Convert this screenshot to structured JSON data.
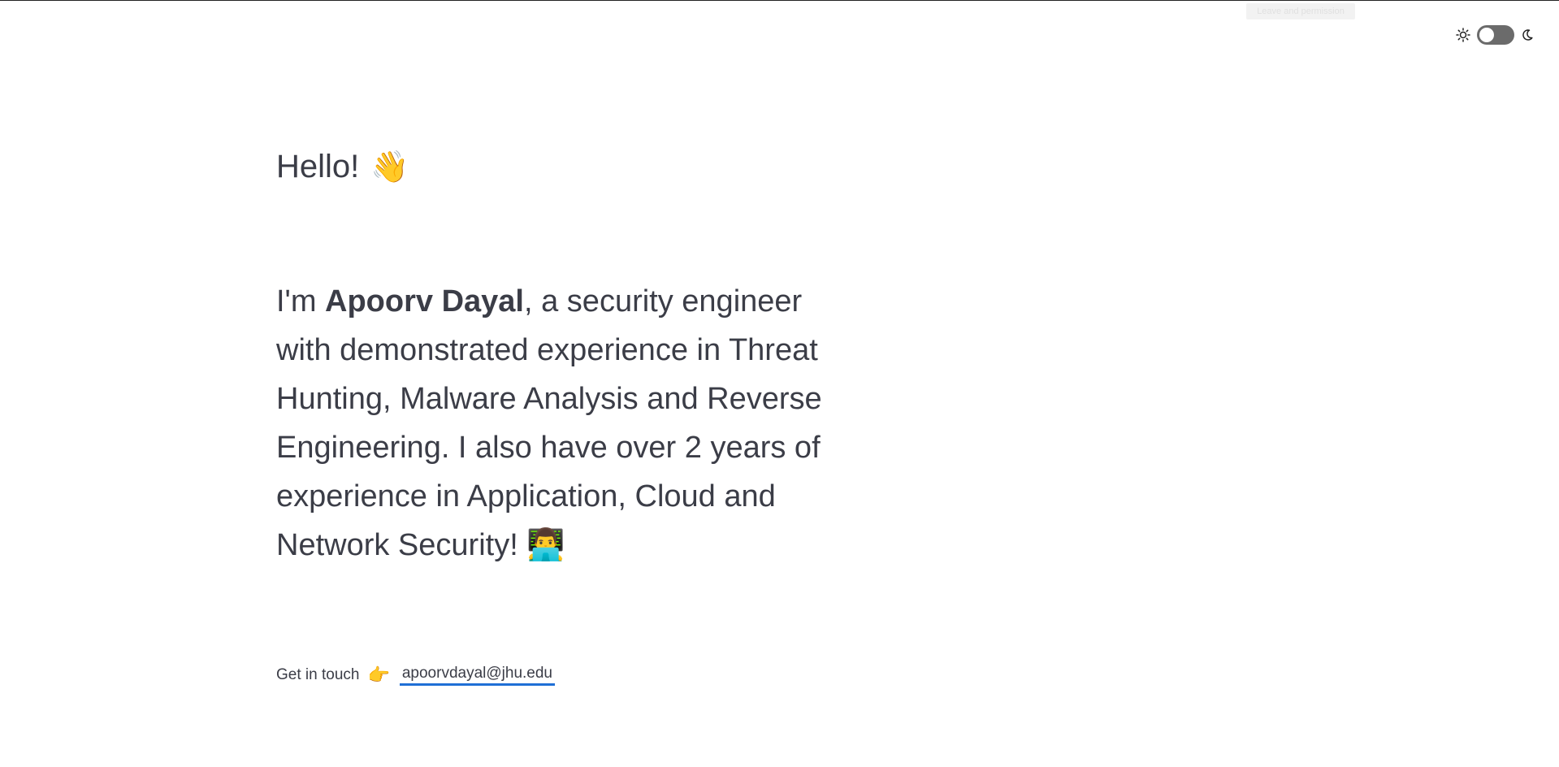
{
  "tooltip": {
    "text": "Leave and permission"
  },
  "theme": {
    "light_icon": "sun-icon",
    "dark_icon": "moon-icon",
    "toggle_state": "off"
  },
  "hero": {
    "greeting": "Hello!",
    "greeting_emoji": "👋",
    "intro_prefix": "I'm ",
    "name": "Apoorv Dayal",
    "intro_rest": ", a security engineer with demonstrated experience in Threat Hunting, Malware Analysis and Reverse Engineering. I also have over 2 years of experience in Application, Cloud and Network Security!",
    "intro_emoji": "👨‍💻"
  },
  "contact": {
    "label": "Get in touch",
    "pointer_emoji": "👉",
    "email": "apoorvdayal@jhu.edu"
  },
  "colors": {
    "text": "#3b3d47",
    "link_underline": "#1f6fd6",
    "toggle_track": "#6b6b6b"
  }
}
